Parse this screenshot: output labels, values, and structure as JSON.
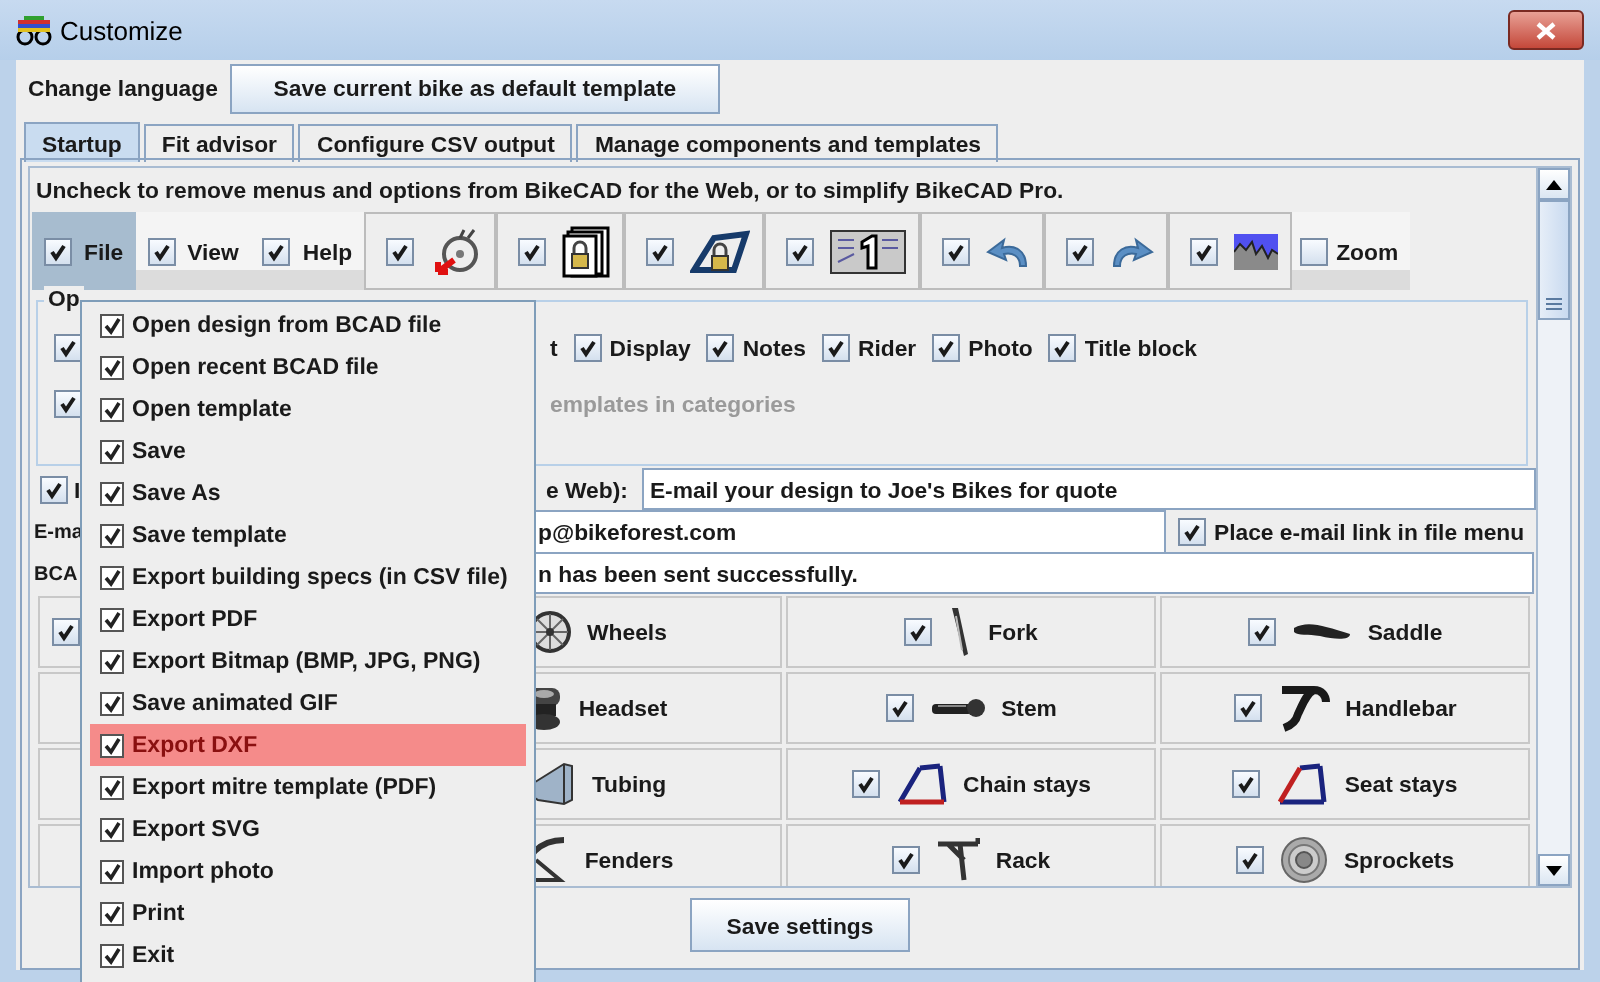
{
  "window": {
    "title": "Customize"
  },
  "top_bar": {
    "label": "Change language",
    "button": "Save current bike as default template"
  },
  "tabs": [
    {
      "label": "Startup",
      "selected": true
    },
    {
      "label": "Fit advisor",
      "selected": false
    },
    {
      "label": "Configure CSV output",
      "selected": false
    },
    {
      "label": "Manage components and templates",
      "selected": false
    }
  ],
  "startup": {
    "instructions": "Uncheck to remove menus and options from BikeCAD for the Web, or to simplify BikeCAD Pro.",
    "toolbar": [
      {
        "kind": "menu",
        "label": "File",
        "checked": true,
        "selected": true
      },
      {
        "kind": "menu",
        "label": "View",
        "checked": true,
        "selected": false
      },
      {
        "kind": "menu",
        "label": "Help",
        "checked": true,
        "selected": false
      },
      {
        "kind": "icon",
        "checked": true
      },
      {
        "kind": "icon",
        "checked": true
      },
      {
        "kind": "icon",
        "checked": true
      },
      {
        "kind": "icon",
        "checked": true
      },
      {
        "kind": "icon",
        "checked": true
      },
      {
        "kind": "icon",
        "checked": true
      },
      {
        "kind": "icon",
        "checked": true
      },
      {
        "kind": "option",
        "label": "Zoom",
        "checked": false
      }
    ],
    "file_menu": [
      {
        "label": "Open design from BCAD file",
        "checked": true,
        "selected": false
      },
      {
        "label": "Open recent BCAD file",
        "checked": true,
        "selected": false
      },
      {
        "label": "Open template",
        "checked": true,
        "selected": false
      },
      {
        "label": "Save",
        "checked": true,
        "selected": false
      },
      {
        "label": "Save As",
        "checked": true,
        "selected": false
      },
      {
        "label": "Save template",
        "checked": true,
        "selected": false
      },
      {
        "label": "Export building specs (in CSV file)",
        "checked": true,
        "selected": false
      },
      {
        "label": "Export PDF",
        "checked": true,
        "selected": false
      },
      {
        "label": "Export Bitmap (BMP, JPG, PNG)",
        "checked": true,
        "selected": false
      },
      {
        "label": "Save animated GIF",
        "checked": true,
        "selected": false
      },
      {
        "label": "Export DXF",
        "checked": true,
        "selected": true
      },
      {
        "label": "Export mitre template (PDF)",
        "checked": true,
        "selected": false
      },
      {
        "label": "Export SVG",
        "checked": true,
        "selected": false
      },
      {
        "label": "Import photo",
        "checked": true,
        "selected": false
      },
      {
        "label": "Print",
        "checked": true,
        "selected": false
      },
      {
        "label": "Exit",
        "checked": true,
        "selected": false
      }
    ],
    "options_group": {
      "legend": "Op",
      "rows": [
        [
          {
            "checked": true
          },
          {
            "label": "t"
          },
          {
            "label": "Display",
            "checked": true
          },
          {
            "label": "Notes",
            "checked": true
          },
          {
            "label": "Rider",
            "checked": true
          },
          {
            "label": "Photo",
            "checked": true
          },
          {
            "label": "Title block",
            "checked": true
          }
        ],
        [
          {
            "checked": true
          },
          {
            "label": "emplates in categories",
            "disabled": true
          }
        ]
      ]
    },
    "web_row": {
      "checked": true,
      "label_start": "I",
      "label_end": "e Web):",
      "value": "E-mail your design to Joe's Bikes for quote"
    },
    "email_row": {
      "label": "E-ma",
      "value": "p@bikeforest.com",
      "link_option": {
        "label": "Place e-mail link in file menu",
        "checked": true
      }
    },
    "bcad_row": {
      "label": "BCA",
      "value": "n has been sent successfully."
    },
    "components": [
      {
        "kind": "check",
        "checked": true
      },
      {
        "kind": "part",
        "label": "Wheels"
      },
      {
        "kind": "part",
        "label": "Fork",
        "checked": true
      },
      {
        "kind": "part",
        "label": "Saddle",
        "checked": true
      },
      {
        "kind": "empty"
      },
      {
        "kind": "part",
        "label": "Headset"
      },
      {
        "kind": "part",
        "label": "Stem",
        "checked": true
      },
      {
        "kind": "part",
        "label": "Handlebar",
        "checked": true
      },
      {
        "kind": "empty"
      },
      {
        "kind": "part",
        "label": "Tubing"
      },
      {
        "kind": "part",
        "label": "Chain stays",
        "checked": true
      },
      {
        "kind": "part",
        "label": "Seat stays",
        "checked": true
      },
      {
        "kind": "empty"
      },
      {
        "kind": "part",
        "label": "Fenders"
      },
      {
        "kind": "part",
        "label": "Rack",
        "checked": true
      },
      {
        "kind": "part",
        "label": "Sprockets",
        "checked": true
      }
    ],
    "save_button": "Save settings"
  }
}
